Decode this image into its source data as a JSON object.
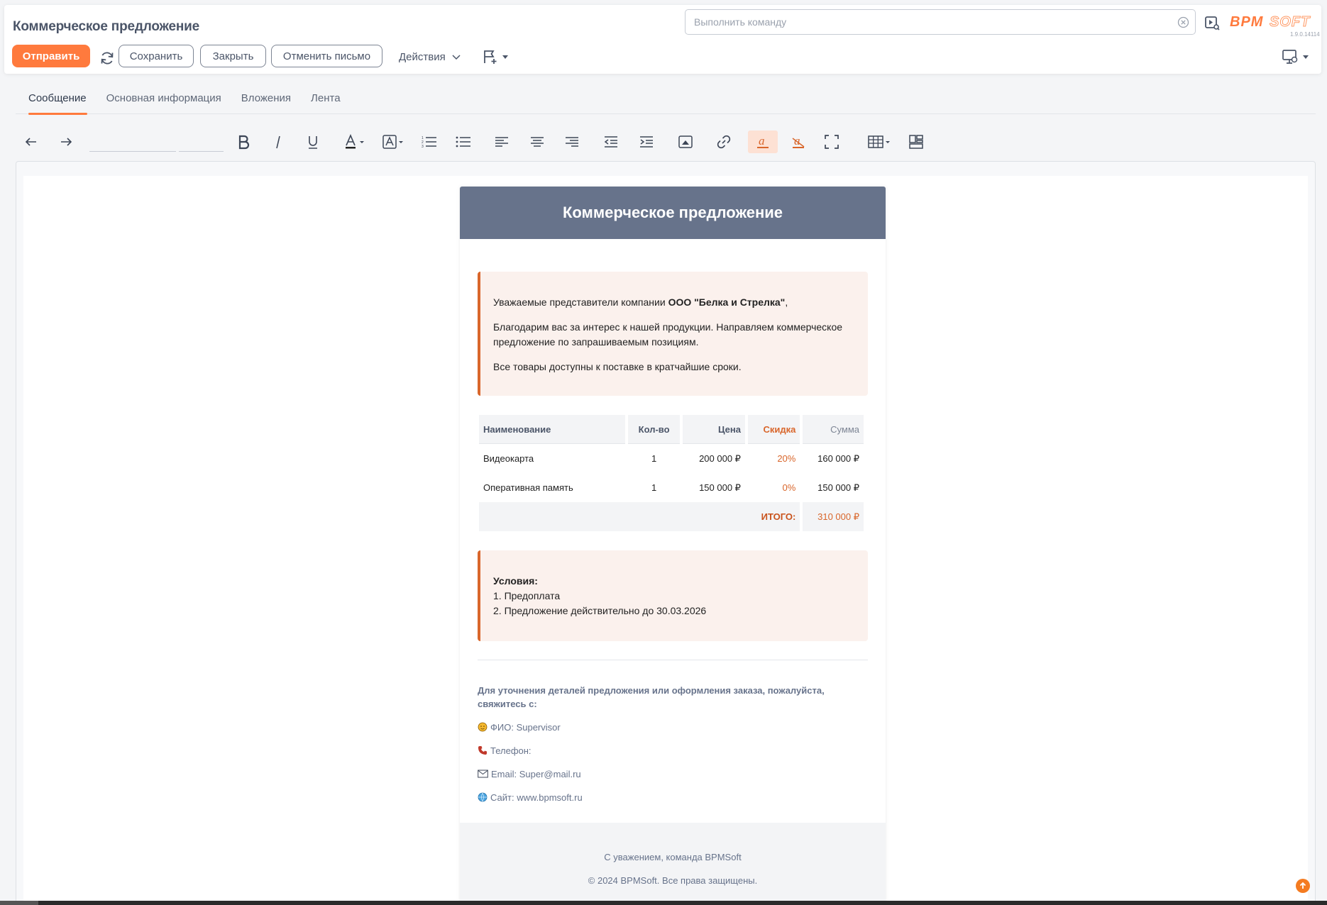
{
  "header": {
    "title": "Коммерческое предложение",
    "command_placeholder": "Выполнить команду",
    "logo_text": "BPMSOFT",
    "version": "1.9.0.14114"
  },
  "toolbar": {
    "send_label": "Отправить",
    "save_label": "Сохранить",
    "close_label": "Закрыть",
    "cancel_label": "Отменить письмо",
    "actions_label": "Действия"
  },
  "tabs": [
    {
      "label": "Сообщение",
      "active": true
    },
    {
      "label": "Основная информация",
      "active": false
    },
    {
      "label": "Вложения",
      "active": false
    },
    {
      "label": "Лента",
      "active": false
    }
  ],
  "editor_tools": [
    "undo-icon",
    "redo-icon",
    "font-family-field",
    "font-size-field",
    "bold-icon",
    "italic-icon",
    "underline-icon",
    "font-color-icon",
    "background-color-icon",
    "numbered-list-icon",
    "bulleted-list-icon",
    "align-left-icon",
    "align-center-icon",
    "align-right-icon",
    "outdent-icon",
    "indent-icon",
    "image-icon",
    "link-icon",
    "highlight-icon",
    "clear-format-icon",
    "fullscreen-icon",
    "table-icon",
    "template-icon"
  ],
  "email": {
    "heading": "Коммерческое предложение",
    "greeting_prefix": "Уважаемые представители компании ",
    "company": "ООО \"Белка и Стрелка\"",
    "greeting_suffix": ",",
    "intro": "Благодарим вас за интерес к нашей продукции. Направляем коммерческое предложение по запрашиваемым позициям.",
    "availability": "Все товары доступны к поставке в кратчайшие сроки.",
    "table": {
      "headers": [
        "Наименование",
        "Кол-во",
        "Цена",
        "Скидка",
        "Сумма"
      ],
      "rows": [
        [
          "Видеокарта",
          "1",
          "200 000 ₽",
          "20%",
          "160 000 ₽"
        ],
        [
          "Оперативная память",
          "1",
          "150 000 ₽",
          "0%",
          "150 000 ₽"
        ]
      ],
      "total_label": "ИТОГО:",
      "total_value": "310 000 ₽"
    },
    "conditions_title": "Условия:",
    "conditions": [
      "1. Предоплата",
      "2. Предложение действительно до 30.03.2026"
    ],
    "contact_title": "Для уточнения деталей предложения или оформления заказа, пожалуйста, свяжитесь с:",
    "contacts": [
      {
        "icon": "person-icon",
        "text": "ФИО: Supervisor"
      },
      {
        "icon": "phone-icon",
        "text": "Телефон:"
      },
      {
        "icon": "envelope-icon",
        "text": "Email: Super@mail.ru"
      },
      {
        "icon": "globe-icon",
        "text": "Сайт: www.bpmsoft.ru"
      }
    ],
    "footer_regards": "С уважением, команда BPMSoft",
    "footer_copyright": "© 2024 BPMSoft. Все права защищены."
  },
  "colors": {
    "accent": "#ff7a3d",
    "header_band": "#67738b",
    "callout_bg": "#fbf1ed",
    "callout_border": "#d9662b"
  }
}
